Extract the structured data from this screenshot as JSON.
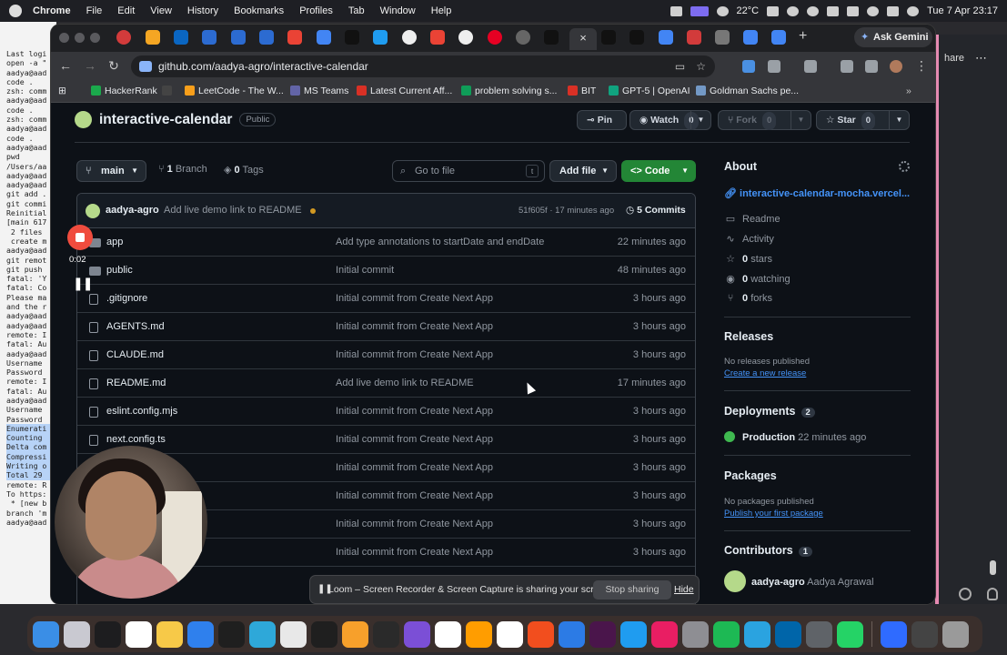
{
  "menubar": {
    "app": "Chrome",
    "items": [
      "File",
      "Edit",
      "View",
      "History",
      "Bookmarks",
      "Profiles",
      "Tab",
      "Window",
      "Help"
    ],
    "temperature": "22°C",
    "datetime": "Tue 7 Apr  23:17"
  },
  "terminal": {
    "lines": [
      "Last logi",
      "open -a \"",
      "aadya@aad",
      "code .",
      "zsh: comm",
      "aadya@aad",
      "code .",
      "zsh: comm",
      "aadya@aad",
      "code .",
      "aadya@aad",
      "pwd",
      "/Users/aa",
      "aadya@aad",
      "aadya@aad",
      "git add .",
      "git commi",
      "Reinitial",
      "[main 617",
      " 2 files ",
      " create m",
      "aadya@aad",
      "git remot",
      "git push ",
      "fatal: 'Y",
      "fatal: Co",
      "",
      "Please ma",
      "and the r",
      "aadya@aad",
      "aadya@aad",
      "remote: I",
      "fatal: Au",
      "aadya@aad",
      "Username ",
      "Password ",
      "remote: I",
      "fatal: Au",
      "aadya@aad",
      "Username ",
      "Password ",
      "Enumerati",
      "Counting ",
      "Delta com",
      "Compressi",
      "Writing o",
      "Total 29 ",
      "remote: R",
      "To https:",
      " * [new b",
      "branch 'm",
      "aadya@aad"
    ]
  },
  "behind_window": {
    "share_label": "hare"
  },
  "browser": {
    "url": "github.com/aadya-agro/interactive-calendar",
    "gemini_label": "Ask Gemini",
    "bookmarks": [
      "HackerRank",
      "LeetCode - The W...",
      "MS Teams",
      "Latest Current Aff...",
      "problem solving s...",
      "BIT",
      "GPT-5 | OpenAI",
      "Goldman Sachs pe..."
    ],
    "bookmark_colors": [
      "#1ba94c",
      "#f89f1b",
      "#6264a7",
      "#d93025",
      "#0f9d58",
      "#d93025",
      "#10a37f",
      "#7399c6"
    ]
  },
  "repo": {
    "name": "interactive-calendar",
    "visibility": "Public",
    "pin_label": "Pin",
    "watch_label": "Watch",
    "watch_count": "0",
    "fork_label": "Fork",
    "fork_count": "0",
    "star_label": "Star",
    "star_count": "0",
    "branch": "main",
    "branch_count": "1",
    "branch_label": "Branch",
    "tag_count": "0",
    "tag_label": "Tags",
    "goto_placeholder": "Go to file",
    "goto_key": "t",
    "add_file_label": "Add file",
    "code_label": "Code",
    "last_commit": {
      "author": "aadya-agro",
      "message": "Add live demo link to README",
      "hash_time": "51f605f · 17 minutes ago",
      "commits_label": "5 Commits"
    },
    "files": [
      {
        "name": "app",
        "type": "folder",
        "message": "Add type annotations to startDate and endDate",
        "time": "22 minutes ago"
      },
      {
        "name": "public",
        "type": "folder",
        "message": "Initial commit",
        "time": "48 minutes ago"
      },
      {
        "name": ".gitignore",
        "type": "file",
        "message": "Initial commit from Create Next App",
        "time": "3 hours ago"
      },
      {
        "name": "AGENTS.md",
        "type": "file",
        "message": "Initial commit from Create Next App",
        "time": "3 hours ago"
      },
      {
        "name": "CLAUDE.md",
        "type": "file",
        "message": "Initial commit from Create Next App",
        "time": "3 hours ago"
      },
      {
        "name": "README.md",
        "type": "file",
        "message": "Add live demo link to README",
        "time": "17 minutes ago"
      },
      {
        "name": "eslint.config.mjs",
        "type": "file",
        "message": "Initial commit from Create Next App",
        "time": "3 hours ago"
      },
      {
        "name": "next.config.ts",
        "type": "file",
        "message": "Initial commit from Create Next App",
        "time": "3 hours ago"
      },
      {
        "name": "",
        "type": "file",
        "message": "Initial commit from Create Next App",
        "time": "3 hours ago"
      },
      {
        "name": "",
        "type": "file",
        "message": "Initial commit from Create Next App",
        "time": "3 hours ago"
      },
      {
        "name": "",
        "type": "file",
        "message": "Initial commit from Create Next App",
        "time": "3 hours ago"
      },
      {
        "name": "",
        "type": "file",
        "message": "Initial commit from Create Next App",
        "time": "3 hours ago"
      }
    ]
  },
  "sidebar": {
    "about_title": "About",
    "link": "interactive-calendar-mocha.vercel...",
    "items": [
      {
        "icon": "book-icon",
        "glyph": "▭",
        "label": "Readme",
        "count": ""
      },
      {
        "icon": "activity-icon",
        "glyph": "∿",
        "label": "Activity",
        "count": ""
      },
      {
        "icon": "star-icon",
        "glyph": "☆",
        "label": "stars",
        "count": "0"
      },
      {
        "icon": "eye-icon",
        "glyph": "◉",
        "label": "watching",
        "count": "0"
      },
      {
        "icon": "fork-icon",
        "glyph": "⑂",
        "label": "forks",
        "count": "0"
      }
    ],
    "releases_title": "Releases",
    "releases_empty": "No releases published",
    "releases_link": "Create a new release",
    "deployments_title": "Deployments",
    "deployments_count": "2",
    "deployment_env": "Production",
    "deployment_time": "22 minutes ago",
    "packages_title": "Packages",
    "packages_empty": "No packages published",
    "packages_link": "Publish your first package",
    "contributors_title": "Contributors",
    "contributors_count": "1",
    "contributor_login": "aadya-agro",
    "contributor_name": "Aadya Agrawal"
  },
  "loom": {
    "timer": "0:02",
    "share_text": "Loom – Screen Recorder & Screen Capture is sharing your screen.",
    "stop_label": "Stop sharing",
    "hide_label": "Hide"
  },
  "dock": {
    "apps": [
      "finder-icon",
      "launchpad-icon",
      "appletv-icon",
      "notion-icon",
      "files-icon",
      "tasks-icon",
      "clion-icon",
      "git-icon",
      "dictionary-icon",
      "clock-icon",
      "pages-icon",
      "terminal-icon",
      "github-desktop-icon",
      "calendar-icon",
      "sublime-icon",
      "chrome-icon",
      "figma-icon",
      "safari-icon",
      "slack-icon",
      "vscode-icon",
      "intellij-icon",
      "settings-icon",
      "spotify-icon",
      "telegram-icon",
      "vscode-blue-icon",
      "sysprefs-icon",
      "whatsapp-icon",
      "network-icon",
      "screen-icon",
      "trash-icon"
    ],
    "colors": [
      "#3a8ee6",
      "#c9c9d1",
      "#1d1d1f",
      "#ffffff",
      "#f7c948",
      "#2f80ed",
      "#1f1f1f",
      "#2ea8d9",
      "#e8e8e8",
      "#1f1f1f",
      "#f7a02b",
      "#2a2a2a",
      "#7b4fd6",
      "#ffffff",
      "#ff9d00",
      "#ffffff",
      "#f24e1e",
      "#2c7be5",
      "#4a154b",
      "#1f9cf0",
      "#e91e63",
      "#8e8e93",
      "#1db954",
      "#2aa3e0",
      "#0065a9",
      "#5f6368",
      "#25d366",
      "#2f6bff",
      "#444",
      "#9a9a9a"
    ]
  }
}
